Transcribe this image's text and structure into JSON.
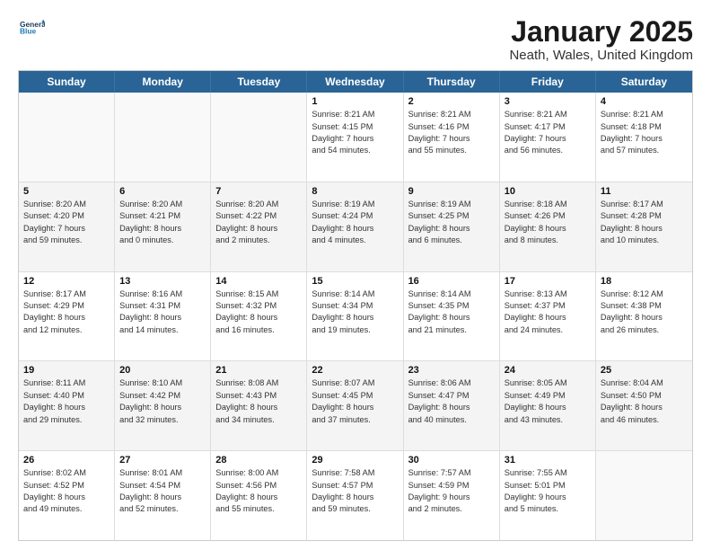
{
  "header": {
    "logo_line1": "General",
    "logo_line2": "Blue",
    "title": "January 2025",
    "subtitle": "Neath, Wales, United Kingdom"
  },
  "days": [
    "Sunday",
    "Monday",
    "Tuesday",
    "Wednesday",
    "Thursday",
    "Friday",
    "Saturday"
  ],
  "rows": [
    [
      {
        "day": "",
        "info": ""
      },
      {
        "day": "",
        "info": ""
      },
      {
        "day": "",
        "info": ""
      },
      {
        "day": "1",
        "info": "Sunrise: 8:21 AM\nSunset: 4:15 PM\nDaylight: 7 hours\nand 54 minutes."
      },
      {
        "day": "2",
        "info": "Sunrise: 8:21 AM\nSunset: 4:16 PM\nDaylight: 7 hours\nand 55 minutes."
      },
      {
        "day": "3",
        "info": "Sunrise: 8:21 AM\nSunset: 4:17 PM\nDaylight: 7 hours\nand 56 minutes."
      },
      {
        "day": "4",
        "info": "Sunrise: 8:21 AM\nSunset: 4:18 PM\nDaylight: 7 hours\nand 57 minutes."
      }
    ],
    [
      {
        "day": "5",
        "info": "Sunrise: 8:20 AM\nSunset: 4:20 PM\nDaylight: 7 hours\nand 59 minutes."
      },
      {
        "day": "6",
        "info": "Sunrise: 8:20 AM\nSunset: 4:21 PM\nDaylight: 8 hours\nand 0 minutes."
      },
      {
        "day": "7",
        "info": "Sunrise: 8:20 AM\nSunset: 4:22 PM\nDaylight: 8 hours\nand 2 minutes."
      },
      {
        "day": "8",
        "info": "Sunrise: 8:19 AM\nSunset: 4:24 PM\nDaylight: 8 hours\nand 4 minutes."
      },
      {
        "day": "9",
        "info": "Sunrise: 8:19 AM\nSunset: 4:25 PM\nDaylight: 8 hours\nand 6 minutes."
      },
      {
        "day": "10",
        "info": "Sunrise: 8:18 AM\nSunset: 4:26 PM\nDaylight: 8 hours\nand 8 minutes."
      },
      {
        "day": "11",
        "info": "Sunrise: 8:17 AM\nSunset: 4:28 PM\nDaylight: 8 hours\nand 10 minutes."
      }
    ],
    [
      {
        "day": "12",
        "info": "Sunrise: 8:17 AM\nSunset: 4:29 PM\nDaylight: 8 hours\nand 12 minutes."
      },
      {
        "day": "13",
        "info": "Sunrise: 8:16 AM\nSunset: 4:31 PM\nDaylight: 8 hours\nand 14 minutes."
      },
      {
        "day": "14",
        "info": "Sunrise: 8:15 AM\nSunset: 4:32 PM\nDaylight: 8 hours\nand 16 minutes."
      },
      {
        "day": "15",
        "info": "Sunrise: 8:14 AM\nSunset: 4:34 PM\nDaylight: 8 hours\nand 19 minutes."
      },
      {
        "day": "16",
        "info": "Sunrise: 8:14 AM\nSunset: 4:35 PM\nDaylight: 8 hours\nand 21 minutes."
      },
      {
        "day": "17",
        "info": "Sunrise: 8:13 AM\nSunset: 4:37 PM\nDaylight: 8 hours\nand 24 minutes."
      },
      {
        "day": "18",
        "info": "Sunrise: 8:12 AM\nSunset: 4:38 PM\nDaylight: 8 hours\nand 26 minutes."
      }
    ],
    [
      {
        "day": "19",
        "info": "Sunrise: 8:11 AM\nSunset: 4:40 PM\nDaylight: 8 hours\nand 29 minutes."
      },
      {
        "day": "20",
        "info": "Sunrise: 8:10 AM\nSunset: 4:42 PM\nDaylight: 8 hours\nand 32 minutes."
      },
      {
        "day": "21",
        "info": "Sunrise: 8:08 AM\nSunset: 4:43 PM\nDaylight: 8 hours\nand 34 minutes."
      },
      {
        "day": "22",
        "info": "Sunrise: 8:07 AM\nSunset: 4:45 PM\nDaylight: 8 hours\nand 37 minutes."
      },
      {
        "day": "23",
        "info": "Sunrise: 8:06 AM\nSunset: 4:47 PM\nDaylight: 8 hours\nand 40 minutes."
      },
      {
        "day": "24",
        "info": "Sunrise: 8:05 AM\nSunset: 4:49 PM\nDaylight: 8 hours\nand 43 minutes."
      },
      {
        "day": "25",
        "info": "Sunrise: 8:04 AM\nSunset: 4:50 PM\nDaylight: 8 hours\nand 46 minutes."
      }
    ],
    [
      {
        "day": "26",
        "info": "Sunrise: 8:02 AM\nSunset: 4:52 PM\nDaylight: 8 hours\nand 49 minutes."
      },
      {
        "day": "27",
        "info": "Sunrise: 8:01 AM\nSunset: 4:54 PM\nDaylight: 8 hours\nand 52 minutes."
      },
      {
        "day": "28",
        "info": "Sunrise: 8:00 AM\nSunset: 4:56 PM\nDaylight: 8 hours\nand 55 minutes."
      },
      {
        "day": "29",
        "info": "Sunrise: 7:58 AM\nSunset: 4:57 PM\nDaylight: 8 hours\nand 59 minutes."
      },
      {
        "day": "30",
        "info": "Sunrise: 7:57 AM\nSunset: 4:59 PM\nDaylight: 9 hours\nand 2 minutes."
      },
      {
        "day": "31",
        "info": "Sunrise: 7:55 AM\nSunset: 5:01 PM\nDaylight: 9 hours\nand 5 minutes."
      },
      {
        "day": "",
        "info": ""
      }
    ]
  ]
}
